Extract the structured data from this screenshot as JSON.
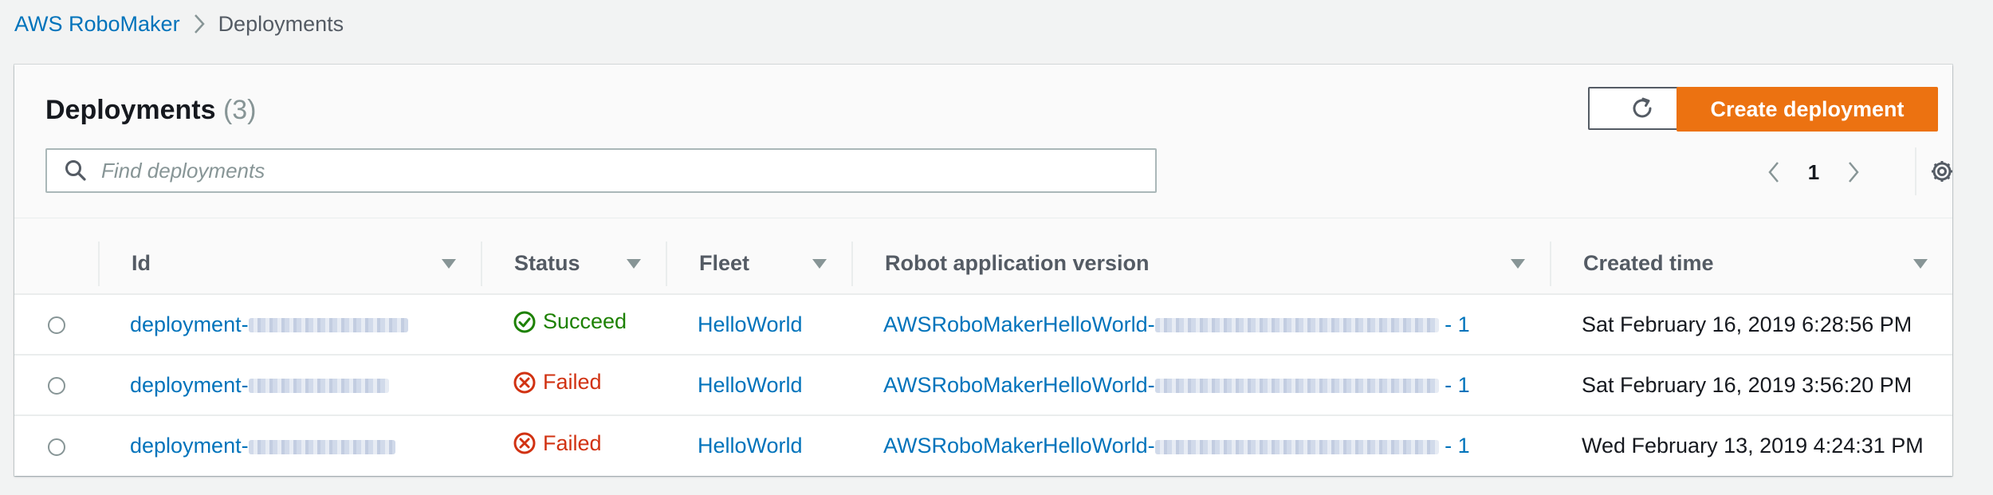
{
  "breadcrumb": {
    "root": "AWS RoboMaker",
    "current": "Deployments"
  },
  "panel": {
    "title": "Deployments",
    "count": "(3)"
  },
  "toolbar": {
    "create_label": "Create deployment"
  },
  "search": {
    "placeholder": "Find deployments",
    "value": ""
  },
  "pagination": {
    "page": "1"
  },
  "table": {
    "columns": [
      "Id",
      "Status",
      "Fleet",
      "Robot application version",
      "Created time"
    ],
    "rows": [
      {
        "id": "deployment-",
        "status": "Succeed",
        "status_type": "success",
        "fleet": "HelloWorld",
        "version_prefix": "AWSRoboMakerHelloWorld-",
        "version_suffix": " - 1",
        "created": "Sat February 16, 2019 6:28:56 PM"
      },
      {
        "id": "deployment-",
        "status": "Failed",
        "status_type": "failed",
        "fleet": "HelloWorld",
        "version_prefix": "AWSRoboMakerHelloWorld-",
        "version_suffix": " - 1",
        "created": "Sat February 16, 2019 3:56:20 PM"
      },
      {
        "id": "deployment-",
        "status": "Failed",
        "status_type": "failed",
        "fleet": "HelloWorld",
        "version_prefix": "AWSRoboMakerHelloWorld-",
        "version_suffix": " - 1",
        "created": "Wed February 13, 2019 4:24:31 PM"
      }
    ]
  },
  "colors": {
    "link": "#0073bb",
    "primary_button": "#ec7211",
    "success": "#1d8102",
    "error": "#d13212"
  },
  "icons": {
    "breadcrumb_separator": "chevron-right-icon",
    "refresh": "refresh-icon",
    "search": "search-icon",
    "prev": "chevron-left-icon",
    "next": "chevron-right-icon",
    "settings": "gear-icon",
    "sort": "caret-down-icon",
    "success": "check-circle-icon",
    "failed": "x-circle-icon"
  }
}
